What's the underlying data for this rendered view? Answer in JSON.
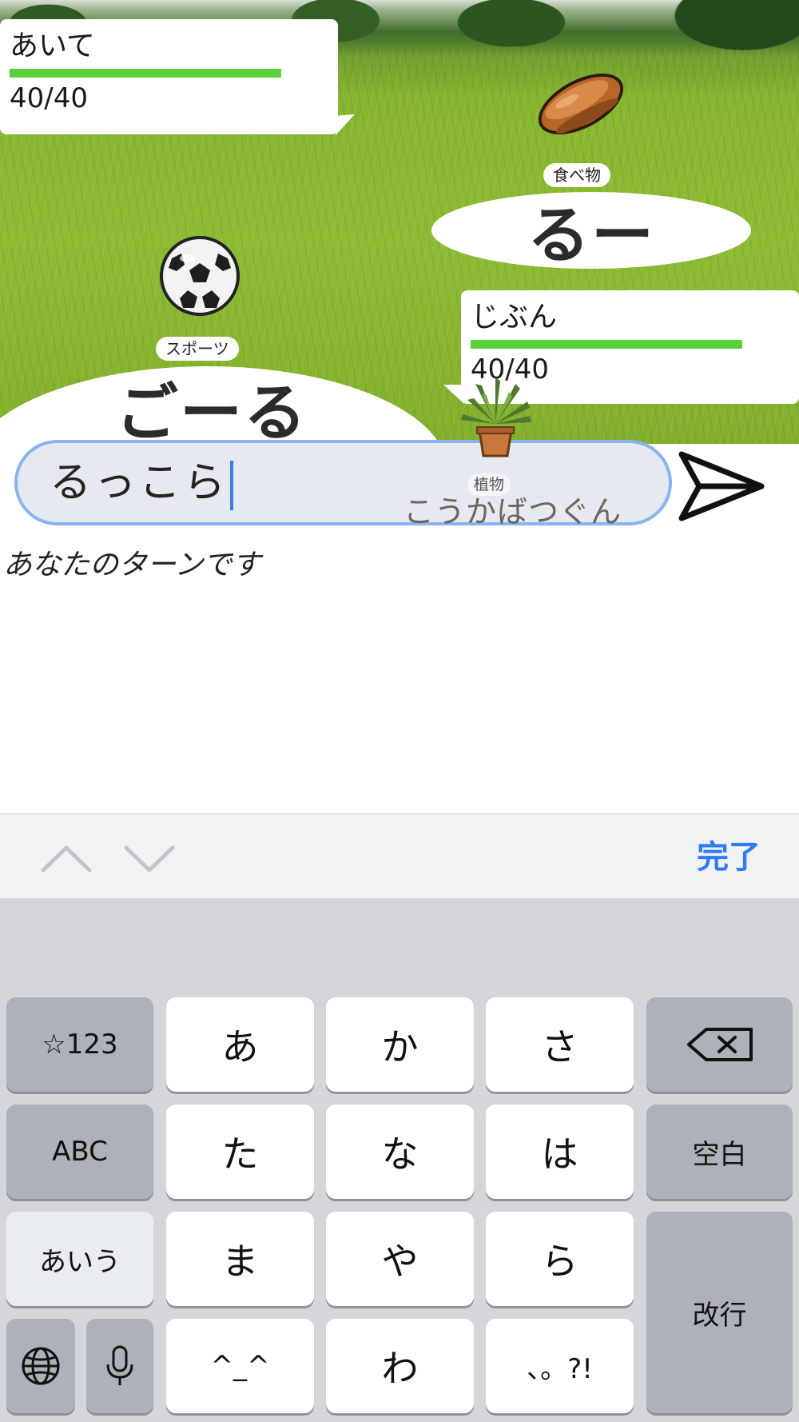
{
  "battle": {
    "opponent": {
      "label": "あいて",
      "hp_text": "40/40",
      "hp_fraction": 1.0,
      "word": "るー",
      "category": "食べ物",
      "sprite": "bread-icon"
    },
    "player": {
      "label": "じぶん",
      "hp_text": "40/40",
      "hp_fraction": 1.0,
      "word": "ごーる",
      "category": "スポーツ",
      "sprite": "soccer-ball-icon"
    },
    "preview": {
      "category": "植物",
      "effect": "こうかばつぐん",
      "sprite": "potted-plant-icon"
    },
    "colors": {
      "hp_bar": "#59d13f",
      "input_border": "#8ab4ef",
      "accent": "#2f7cf0"
    }
  },
  "input": {
    "value": "るっこら"
  },
  "send": {
    "icon": "send-icon"
  },
  "status": {
    "turn_text": "あなたのターンです"
  },
  "accessory": {
    "prev_icon": "chevron-up-icon",
    "next_icon": "chevron-down-icon",
    "done_label": "完了"
  },
  "keyboard": {
    "row1": [
      "☆123",
      "あ",
      "か",
      "さ"
    ],
    "row2": [
      "ABC",
      "た",
      "な",
      "は",
      "空白"
    ],
    "row3": [
      "あいう",
      "ま",
      "や",
      "ら"
    ],
    "row4": [
      "^_^",
      "わ",
      "、。?!"
    ],
    "return_label": "改行",
    "backspace_icon": "backspace-icon",
    "globe_icon": "globe-icon",
    "mic_icon": "microphone-icon"
  }
}
